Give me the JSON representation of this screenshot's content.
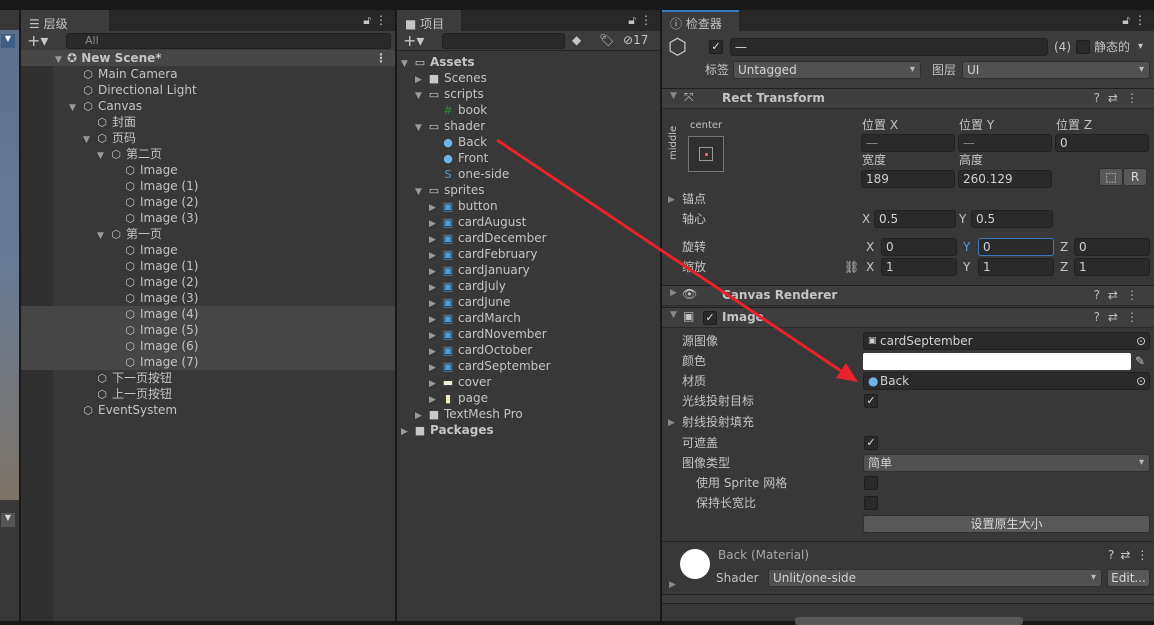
{
  "hierarchy": {
    "tab": "层级",
    "search_placeholder": "All",
    "scene": "New Scene*",
    "items": [
      {
        "label": "Main Camera",
        "level": 1,
        "tri": ""
      },
      {
        "label": "Directional Light",
        "level": 1,
        "tri": ""
      },
      {
        "label": "Canvas",
        "level": 1,
        "tri": "▼"
      },
      {
        "label": "封面",
        "level": 2,
        "tri": ""
      },
      {
        "label": "页码",
        "level": 2,
        "tri": "▼"
      },
      {
        "label": "第二页",
        "level": 3,
        "tri": "▼"
      },
      {
        "label": "Image",
        "level": 4,
        "tri": ""
      },
      {
        "label": "Image (1)",
        "level": 4,
        "tri": ""
      },
      {
        "label": "Image (2)",
        "level": 4,
        "tri": ""
      },
      {
        "label": "Image (3)",
        "level": 4,
        "tri": ""
      },
      {
        "label": "第一页",
        "level": 3,
        "tri": "▼"
      },
      {
        "label": "Image",
        "level": 4,
        "tri": ""
      },
      {
        "label": "Image (1)",
        "level": 4,
        "tri": ""
      },
      {
        "label": "Image (2)",
        "level": 4,
        "tri": ""
      },
      {
        "label": "Image (3)",
        "level": 4,
        "tri": ""
      },
      {
        "label": "Image (4)",
        "level": 4,
        "tri": "",
        "selected": true
      },
      {
        "label": "Image (5)",
        "level": 4,
        "tri": "",
        "selected": true
      },
      {
        "label": "Image (6)",
        "level": 4,
        "tri": "",
        "selected": true
      },
      {
        "label": "Image (7)",
        "level": 4,
        "tri": "",
        "selected": true
      },
      {
        "label": "下一页按钮",
        "level": 2,
        "tri": ""
      },
      {
        "label": "上一页按钮",
        "level": 2,
        "tri": ""
      },
      {
        "label": "EventSystem",
        "level": 1,
        "tri": ""
      }
    ]
  },
  "project": {
    "tab": "项目",
    "hidden_count": "17",
    "items": [
      {
        "label": "Assets",
        "level": 0,
        "tri": "▼",
        "icon": "folder-open-icon",
        "bold": true
      },
      {
        "label": "Scenes",
        "level": 1,
        "tri": "▶",
        "icon": "folder-icon"
      },
      {
        "label": "scripts",
        "level": 1,
        "tri": "▼",
        "icon": "folder-open-icon"
      },
      {
        "label": "book",
        "level": 2,
        "tri": "",
        "icon": "csharp-script-icon"
      },
      {
        "label": "shader",
        "level": 1,
        "tri": "▼",
        "icon": "folder-open-icon"
      },
      {
        "label": "Back",
        "level": 2,
        "tri": "",
        "icon": "material-icon"
      },
      {
        "label": "Front",
        "level": 2,
        "tri": "",
        "icon": "material-icon"
      },
      {
        "label": "one-side",
        "level": 2,
        "tri": "",
        "icon": "shader-icon"
      },
      {
        "label": "sprites",
        "level": 1,
        "tri": "▼",
        "icon": "folder-open-icon"
      },
      {
        "label": "button",
        "level": 2,
        "tri": "▶",
        "icon": "sprite-icon"
      },
      {
        "label": "cardAugust",
        "level": 2,
        "tri": "▶",
        "icon": "sprite-icon"
      },
      {
        "label": "cardDecember",
        "level": 2,
        "tri": "▶",
        "icon": "sprite-icon"
      },
      {
        "label": "cardFebruary",
        "level": 2,
        "tri": "▶",
        "icon": "sprite-icon"
      },
      {
        "label": "cardJanuary",
        "level": 2,
        "tri": "▶",
        "icon": "sprite-icon"
      },
      {
        "label": "cardJuly",
        "level": 2,
        "tri": "▶",
        "icon": "sprite-icon"
      },
      {
        "label": "cardJune",
        "level": 2,
        "tri": "▶",
        "icon": "sprite-icon"
      },
      {
        "label": "cardMarch",
        "level": 2,
        "tri": "▶",
        "icon": "sprite-icon"
      },
      {
        "label": "cardNovember",
        "level": 2,
        "tri": "▶",
        "icon": "sprite-icon"
      },
      {
        "label": "cardOctober",
        "level": 2,
        "tri": "▶",
        "icon": "sprite-icon"
      },
      {
        "label": "cardSeptember",
        "level": 2,
        "tri": "▶",
        "icon": "sprite-icon"
      },
      {
        "label": "cover",
        "level": 2,
        "tri": "▶",
        "icon": "sprite-cover-icon"
      },
      {
        "label": "page",
        "level": 2,
        "tri": "▶",
        "icon": "sprite-page-icon"
      },
      {
        "label": "TextMesh Pro",
        "level": 1,
        "tri": "▶",
        "icon": "folder-icon"
      },
      {
        "label": "Packages",
        "level": 0,
        "tri": "▶",
        "icon": "folder-icon",
        "bold": true
      }
    ]
  },
  "inspector": {
    "tab": "检查器",
    "name": "—",
    "count": "(4)",
    "static_label": "静态的",
    "tag_label": "标签",
    "tag": "Untagged",
    "layer_label": "图层",
    "layer": "UI",
    "rect": {
      "title": "Rect Transform",
      "anchor_h": "center",
      "anchor_v": "middle",
      "pos_x_label": "位置 X",
      "pos_y_label": "位置 Y",
      "pos_z_label": "位置 Z",
      "pos_x": "—",
      "pos_y": "—",
      "pos_z": "0",
      "width_label": "宽度",
      "height_label": "高度",
      "width": "189",
      "height": "260.129",
      "r_button": "R",
      "anchors_label": "锚点",
      "pivot_label": "轴心",
      "pivot_x": "0.5",
      "pivot_y": "0.5",
      "rotation_label": "旋转",
      "rot_x": "0",
      "rot_y": "0",
      "rot_z": "0",
      "scale_label": "缩放",
      "scale_x": "1",
      "scale_y": "1",
      "scale_z": "1",
      "x": "X",
      "y": "Y",
      "z": "Z"
    },
    "canvas_renderer": {
      "title": "Canvas Renderer"
    },
    "image": {
      "title": "Image",
      "source_label": "源图像",
      "source": "cardSeptember",
      "color_label": "颜色",
      "color": "#ffffff",
      "material_label": "材质",
      "material": "Back",
      "raycast_label": "光线投射目标",
      "raycast_padding_label": "射线投射填充",
      "maskable_label": "可遮盖",
      "image_type_label": "图像类型",
      "image_type": "简单",
      "use_sprite_mesh_label": "使用 Sprite 网格",
      "preserve_aspect_label": "保持长宽比",
      "set_native_size": "设置原生大小"
    },
    "material": {
      "title": "Back (Material)",
      "shader_label": "Shader",
      "shader": "Unlit/one-side",
      "edit": "Edit..."
    }
  },
  "colors": {
    "accent": "#3a79bb",
    "annotation_arrow": "#e8232a"
  }
}
